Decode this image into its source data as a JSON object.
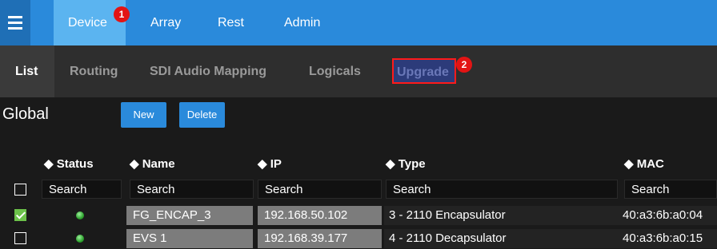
{
  "topnav": {
    "tabs": [
      {
        "label": "Device",
        "badge": "1"
      },
      {
        "label": "Array"
      },
      {
        "label": "Rest"
      },
      {
        "label": "Admin"
      }
    ]
  },
  "subnav": {
    "tabs": [
      {
        "label": "List"
      },
      {
        "label": "Routing"
      },
      {
        "label": "SDI Audio Mapping"
      },
      {
        "label": "Logicals"
      },
      {
        "label": "Upgrade",
        "badge": "2"
      }
    ]
  },
  "section": {
    "title": "Global",
    "new_label": "New",
    "delete_label": "Delete"
  },
  "table": {
    "headers": [
      {
        "label": "Status",
        "sort": "◆"
      },
      {
        "label": "Name",
        "sort": "◆"
      },
      {
        "label": "IP",
        "sort": "◆"
      },
      {
        "label": "Type",
        "sort": "◆"
      },
      {
        "label": "MAC",
        "sort": "◆"
      }
    ],
    "search": [
      "Search",
      "Search",
      "Search",
      "Search",
      "Search"
    ],
    "rows": [
      {
        "checked": true,
        "status": "online",
        "name": "FG_ENCAP_3",
        "ip": "192.168.50.102",
        "type": "3 - 2110 Encapsulator",
        "mac": "40:a3:6b:a0:04"
      },
      {
        "checked": false,
        "status": "online",
        "name": "EVS 1",
        "ip": "192.168.39.177",
        "type": "4 - 2110 Decapsulator",
        "mac": "40:a3:6b:a0:15"
      }
    ]
  },
  "colors": {
    "accent": "#2a8adb",
    "badge": "#e31414",
    "status_online": "#2ea32e"
  }
}
